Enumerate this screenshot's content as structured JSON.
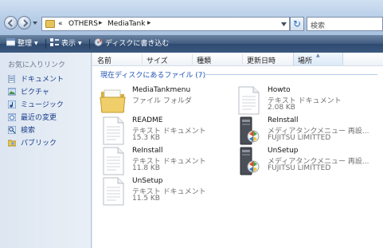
{
  "address": {
    "overflow": "«",
    "crumbs": [
      "OTHERS",
      "MediaTank"
    ]
  },
  "search": {
    "placeholder": "検索"
  },
  "toolbar": {
    "organize": "整理",
    "view": "表示",
    "burn": "ディスクに書き込む"
  },
  "nav": {
    "title": "お気に入りリンク",
    "items": [
      {
        "label": "ドキュメント",
        "icon": "documents-icon"
      },
      {
        "label": "ピクチャ",
        "icon": "pictures-icon"
      },
      {
        "label": "ミュージック",
        "icon": "music-icon"
      },
      {
        "label": "最近の変更",
        "icon": "recent-icon"
      },
      {
        "label": "検索",
        "icon": "search-icon"
      },
      {
        "label": "パブリック",
        "icon": "public-folder-icon"
      }
    ]
  },
  "columns": [
    "名前",
    "サイズ",
    "種類",
    "更新日時",
    "場所"
  ],
  "group": {
    "label": "現在ディスクにあるファイル (7)"
  },
  "files": [
    {
      "name": "MediaTankmenu",
      "type": "ファイル フォルダ",
      "size": "",
      "icon": "folder-icon"
    },
    {
      "name": "Howto",
      "type": "テキスト ドキュメント",
      "size": "2.08 KB",
      "icon": "text-document-icon"
    },
    {
      "name": "README",
      "type": "テキスト ドキュメント",
      "size": "15.3 KB",
      "icon": "text-document-icon"
    },
    {
      "name": "ReInstall",
      "type": "メディアタンクメニュー 再設...",
      "size": "FUJITSU LIMITTED",
      "icon": "installer-icon"
    },
    {
      "name": "ReInstall",
      "type": "テキスト ドキュメント",
      "size": "11.8 KB",
      "icon": "text-document-icon"
    },
    {
      "name": "UnSetup",
      "type": "メディアタンクメニュー 再設...",
      "size": "FUJITSU LIMITTED",
      "icon": "installer-icon"
    },
    {
      "name": "UnSetup",
      "type": "テキスト ドキュメント",
      "size": "11.5 KB",
      "icon": "text-document-icon"
    }
  ]
}
